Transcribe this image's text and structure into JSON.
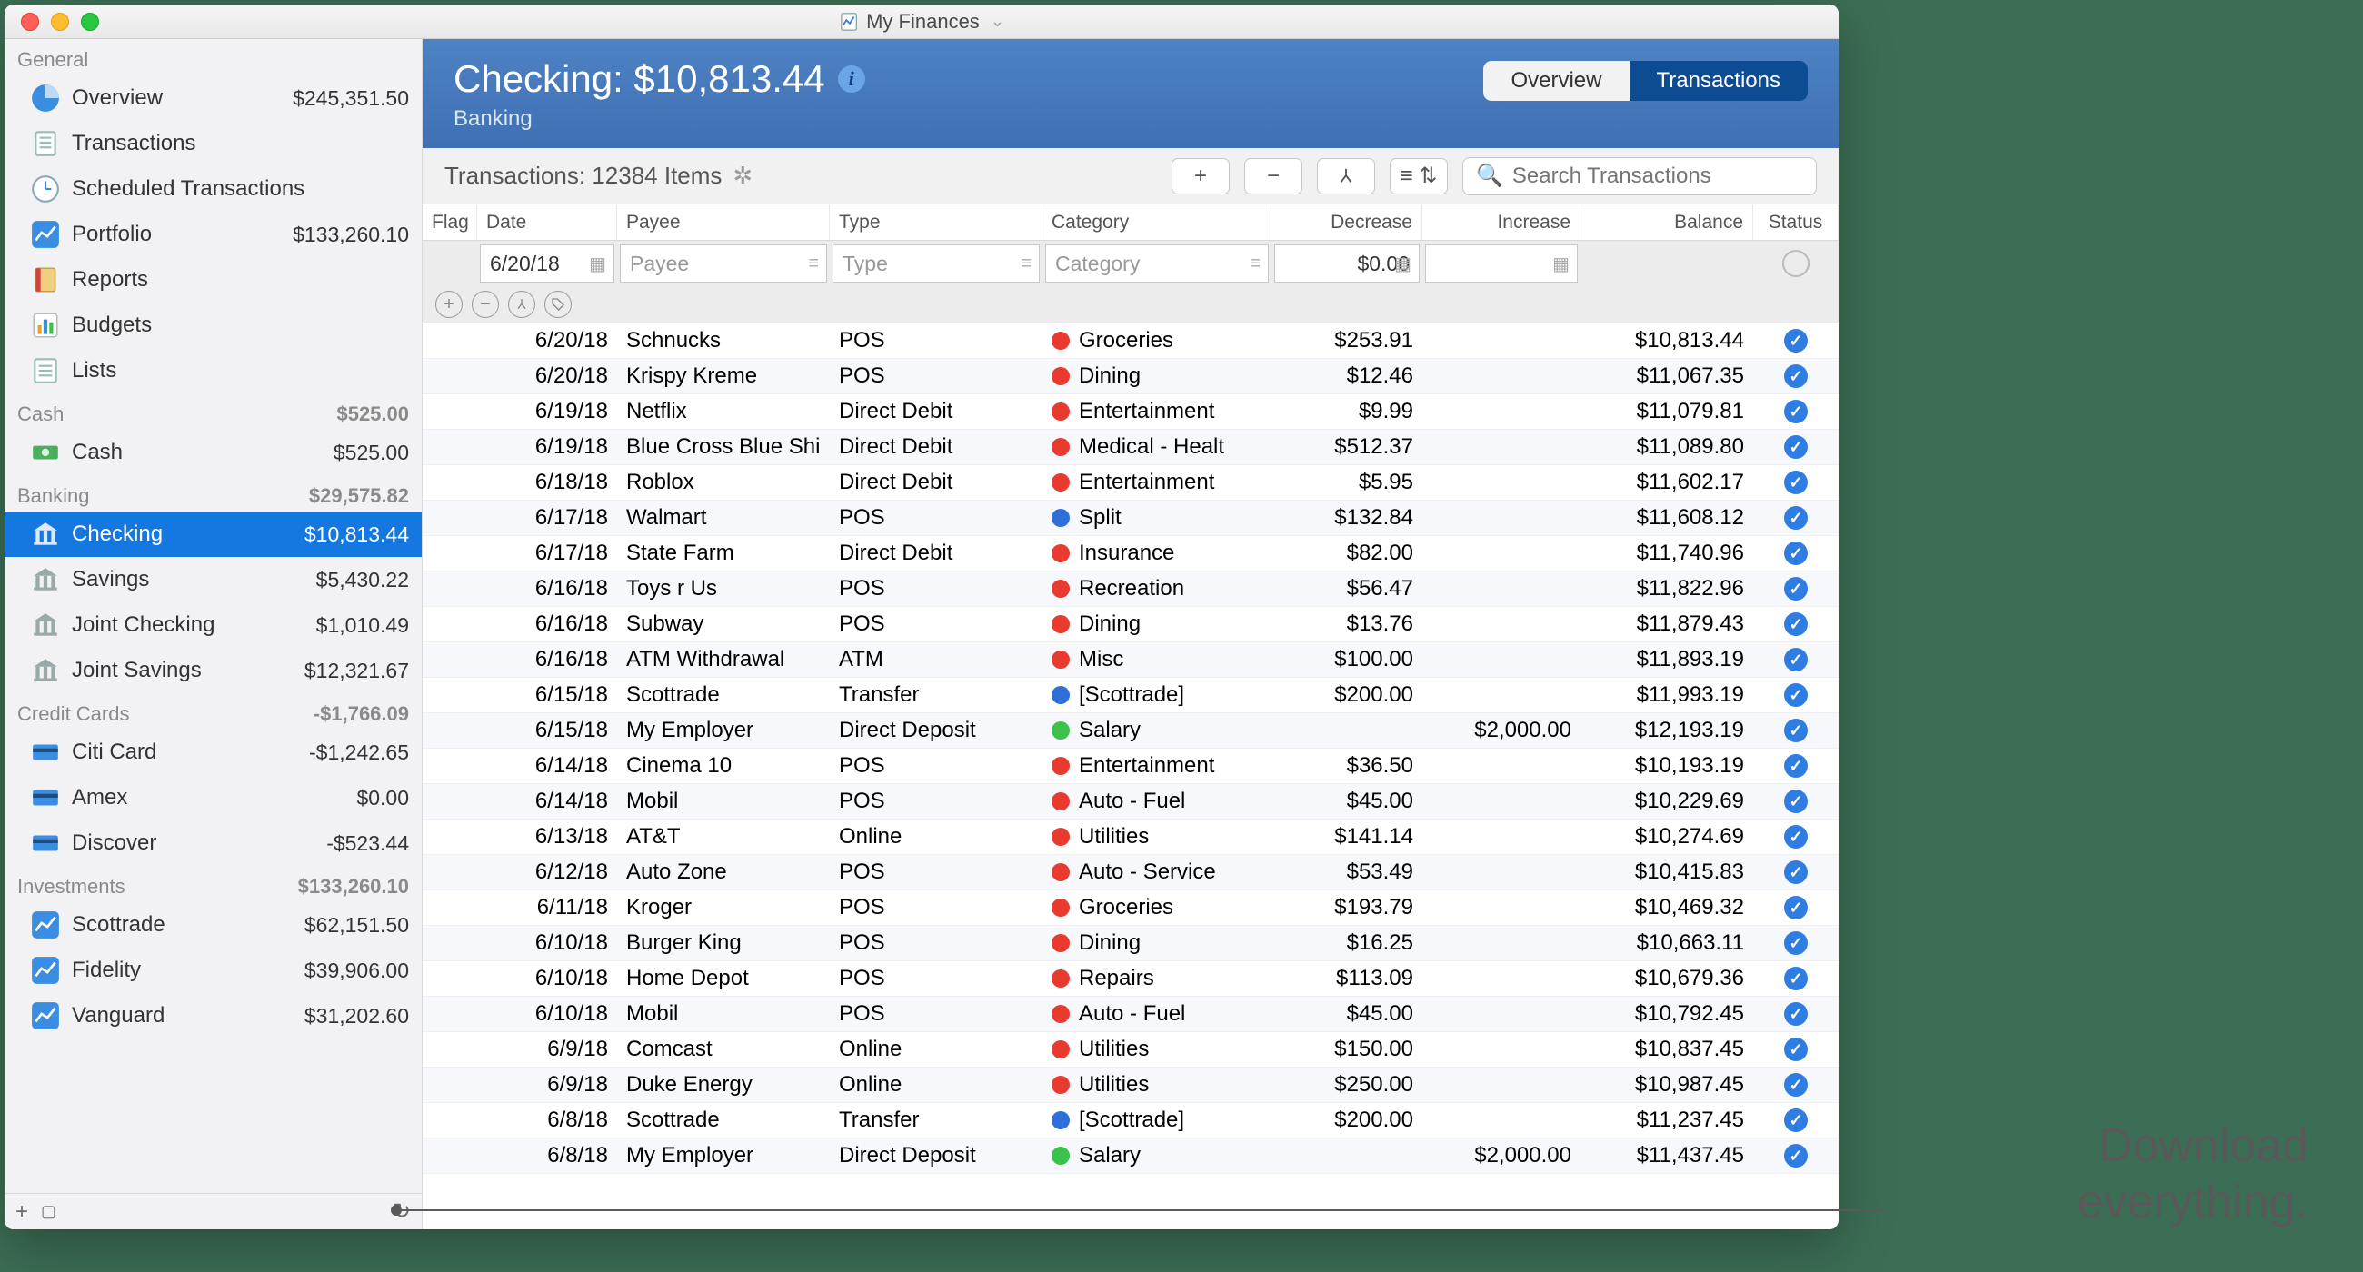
{
  "window_title": "My Finances",
  "segmented": {
    "overview": "Overview",
    "transactions": "Transactions"
  },
  "hero": {
    "title": "Checking: $10,813.44",
    "subtitle": "Banking"
  },
  "toolbar": {
    "label": "Transactions: 12384 Items",
    "search_placeholder": "Search Transactions"
  },
  "annotation": {
    "line1": "Download",
    "line2": "everything."
  },
  "sidebar": {
    "general_header": "General",
    "cash_header": "Cash",
    "cash_total": "$525.00",
    "banking_header": "Banking",
    "banking_total": "$29,575.82",
    "cc_header": "Credit Cards",
    "cc_total": "-$1,766.09",
    "inv_header": "Investments",
    "inv_total": "$133,260.10",
    "items": {
      "overview": {
        "label": "Overview",
        "amt": "$245,351.50"
      },
      "transactions": {
        "label": "Transactions"
      },
      "scheduled": {
        "label": "Scheduled Transactions"
      },
      "portfolio": {
        "label": "Portfolio",
        "amt": "$133,260.10"
      },
      "reports": {
        "label": "Reports"
      },
      "budgets": {
        "label": "Budgets"
      },
      "lists": {
        "label": "Lists"
      },
      "cash": {
        "label": "Cash",
        "amt": "$525.00"
      },
      "checking": {
        "label": "Checking",
        "amt": "$10,813.44"
      },
      "savings": {
        "label": "Savings",
        "amt": "$5,430.22"
      },
      "jchecking": {
        "label": "Joint Checking",
        "amt": "$1,010.49"
      },
      "jsavings": {
        "label": "Joint Savings",
        "amt": "$12,321.67"
      },
      "citi": {
        "label": "Citi Card",
        "amt": "-$1,242.65"
      },
      "amex": {
        "label": "Amex",
        "amt": "$0.00"
      },
      "discover": {
        "label": "Discover",
        "amt": "-$523.44"
      },
      "scottrade": {
        "label": "Scottrade",
        "amt": "$62,151.50"
      },
      "fidelity": {
        "label": "Fidelity",
        "amt": "$39,906.00"
      },
      "vanguard": {
        "label": "Vanguard",
        "amt": "$31,202.60"
      }
    }
  },
  "columns": {
    "flag": "Flag",
    "date": "Date",
    "payee": "Payee",
    "type": "Type",
    "category": "Category",
    "decrease": "Decrease",
    "increase": "Increase",
    "balance": "Balance",
    "status": "Status"
  },
  "entry": {
    "date": "6/20/18",
    "payee": "Payee",
    "type": "Type",
    "category": "Category",
    "decrease": "$0.00"
  },
  "cat_colors": {
    "red": "#e83a2f",
    "blue": "#2e6fd8",
    "green": "#3cc24a"
  },
  "transactions": [
    {
      "date": "6/20/18",
      "payee": "Schnucks",
      "type": "POS",
      "cat": "Groceries",
      "dot": "red",
      "dec": "$253.91",
      "inc": "",
      "bal": "$10,813.44"
    },
    {
      "date": "6/20/18",
      "payee": "Krispy Kreme",
      "type": "POS",
      "cat": "Dining",
      "dot": "red",
      "dec": "$12.46",
      "inc": "",
      "bal": "$11,067.35"
    },
    {
      "date": "6/19/18",
      "payee": "Netflix",
      "type": "Direct Debit",
      "cat": "Entertainment",
      "dot": "red",
      "dec": "$9.99",
      "inc": "",
      "bal": "$11,079.81"
    },
    {
      "date": "6/19/18",
      "payee": "Blue Cross Blue Shi",
      "type": "Direct Debit",
      "cat": "Medical - Healt",
      "dot": "red",
      "dec": "$512.37",
      "inc": "",
      "bal": "$11,089.80"
    },
    {
      "date": "6/18/18",
      "payee": "Roblox",
      "type": "Direct Debit",
      "cat": "Entertainment",
      "dot": "red",
      "dec": "$5.95",
      "inc": "",
      "bal": "$11,602.17"
    },
    {
      "date": "6/17/18",
      "payee": "Walmart",
      "type": "POS",
      "cat": "Split",
      "dot": "blue",
      "dec": "$132.84",
      "inc": "",
      "bal": "$11,608.12"
    },
    {
      "date": "6/17/18",
      "payee": "State Farm",
      "type": "Direct Debit",
      "cat": "Insurance",
      "dot": "red",
      "dec": "$82.00",
      "inc": "",
      "bal": "$11,740.96"
    },
    {
      "date": "6/16/18",
      "payee": "Toys r Us",
      "type": "POS",
      "cat": "Recreation",
      "dot": "red",
      "dec": "$56.47",
      "inc": "",
      "bal": "$11,822.96"
    },
    {
      "date": "6/16/18",
      "payee": "Subway",
      "type": "POS",
      "cat": "Dining",
      "dot": "red",
      "dec": "$13.76",
      "inc": "",
      "bal": "$11,879.43"
    },
    {
      "date": "6/16/18",
      "payee": "ATM Withdrawal",
      "type": "ATM",
      "cat": "Misc",
      "dot": "red",
      "dec": "$100.00",
      "inc": "",
      "bal": "$11,893.19"
    },
    {
      "date": "6/15/18",
      "payee": "Scottrade",
      "type": "Transfer",
      "cat": "[Scottrade]",
      "dot": "blue",
      "dec": "$200.00",
      "inc": "",
      "bal": "$11,993.19"
    },
    {
      "date": "6/15/18",
      "payee": "My Employer",
      "type": "Direct Deposit",
      "cat": "Salary",
      "dot": "green",
      "dec": "",
      "inc": "$2,000.00",
      "bal": "$12,193.19"
    },
    {
      "date": "6/14/18",
      "payee": "Cinema 10",
      "type": "POS",
      "cat": "Entertainment",
      "dot": "red",
      "dec": "$36.50",
      "inc": "",
      "bal": "$10,193.19"
    },
    {
      "date": "6/14/18",
      "payee": "Mobil",
      "type": "POS",
      "cat": "Auto - Fuel",
      "dot": "red",
      "dec": "$45.00",
      "inc": "",
      "bal": "$10,229.69"
    },
    {
      "date": "6/13/18",
      "payee": "AT&T",
      "type": "Online",
      "cat": "Utilities",
      "dot": "red",
      "dec": "$141.14",
      "inc": "",
      "bal": "$10,274.69"
    },
    {
      "date": "6/12/18",
      "payee": "Auto Zone",
      "type": "POS",
      "cat": "Auto - Service",
      "dot": "red",
      "dec": "$53.49",
      "inc": "",
      "bal": "$10,415.83"
    },
    {
      "date": "6/11/18",
      "payee": "Kroger",
      "type": "POS",
      "cat": "Groceries",
      "dot": "red",
      "dec": "$193.79",
      "inc": "",
      "bal": "$10,469.32"
    },
    {
      "date": "6/10/18",
      "payee": "Burger King",
      "type": "POS",
      "cat": "Dining",
      "dot": "red",
      "dec": "$16.25",
      "inc": "",
      "bal": "$10,663.11"
    },
    {
      "date": "6/10/18",
      "payee": "Home Depot",
      "type": "POS",
      "cat": "Repairs",
      "dot": "red",
      "dec": "$113.09",
      "inc": "",
      "bal": "$10,679.36"
    },
    {
      "date": "6/10/18",
      "payee": "Mobil",
      "type": "POS",
      "cat": "Auto - Fuel",
      "dot": "red",
      "dec": "$45.00",
      "inc": "",
      "bal": "$10,792.45"
    },
    {
      "date": "6/9/18",
      "payee": "Comcast",
      "type": "Online",
      "cat": "Utilities",
      "dot": "red",
      "dec": "$150.00",
      "inc": "",
      "bal": "$10,837.45"
    },
    {
      "date": "6/9/18",
      "payee": "Duke Energy",
      "type": "Online",
      "cat": "Utilities",
      "dot": "red",
      "dec": "$250.00",
      "inc": "",
      "bal": "$10,987.45"
    },
    {
      "date": "6/8/18",
      "payee": "Scottrade",
      "type": "Transfer",
      "cat": "[Scottrade]",
      "dot": "blue",
      "dec": "$200.00",
      "inc": "",
      "bal": "$11,237.45"
    },
    {
      "date": "6/8/18",
      "payee": "My Employer",
      "type": "Direct Deposit",
      "cat": "Salary",
      "dot": "green",
      "dec": "",
      "inc": "$2,000.00",
      "bal": "$11,437.45"
    }
  ]
}
